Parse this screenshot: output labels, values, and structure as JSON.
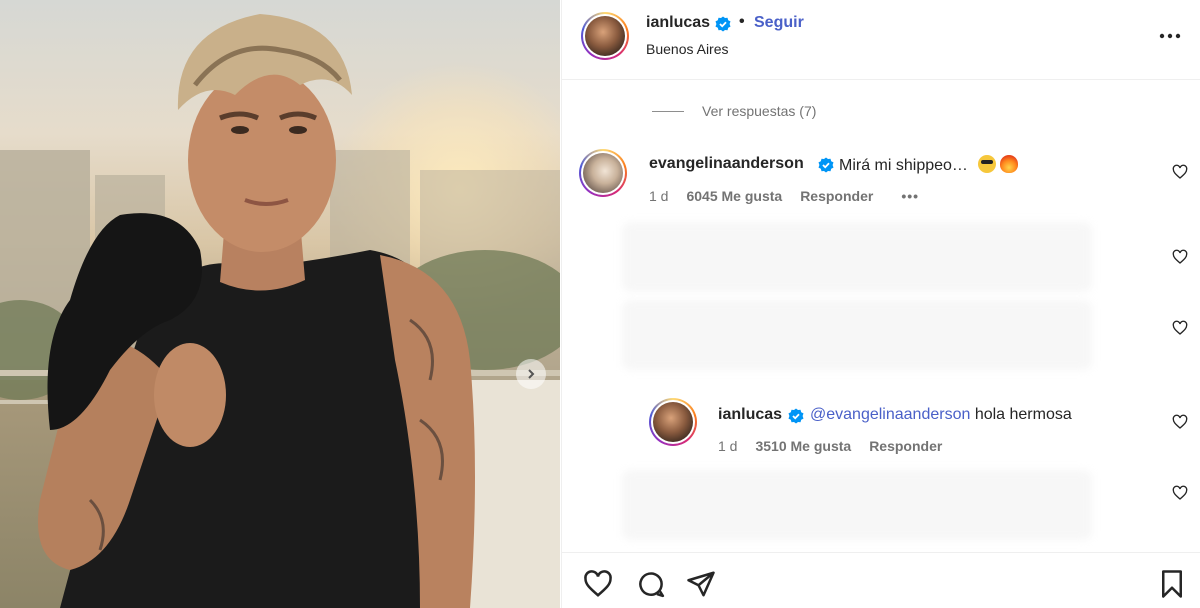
{
  "post": {
    "author": "ianlucas",
    "dot": "•",
    "follow_label": "Seguir",
    "location": "Buenos Aires"
  },
  "comments": {
    "view_replies": "Ver respuestas (7)",
    "top": {
      "user": "evangelinaanderson",
      "text": "Mirá mi shippeo…",
      "time": "1 d",
      "likes": "6045 Me gusta",
      "reply_label": "Responder",
      "more": "•••"
    },
    "reply": {
      "user": "ianlucas",
      "mention": "@evangelinaanderson",
      "text": "hola hermosa",
      "time": "1 d",
      "likes": "3510 Me gusta",
      "reply_label": "Responder"
    }
  },
  "icons": {
    "verified": "verified-badge-icon",
    "more": "more-options-icon",
    "like": "heart-icon",
    "comment": "comment-icon",
    "share": "send-icon",
    "save": "bookmark-icon",
    "carousel": "chevron-right-icon"
  },
  "colors": {
    "link": "#4a60c8",
    "verified": "#0095f6",
    "text": "#262626",
    "muted": "#737373"
  }
}
